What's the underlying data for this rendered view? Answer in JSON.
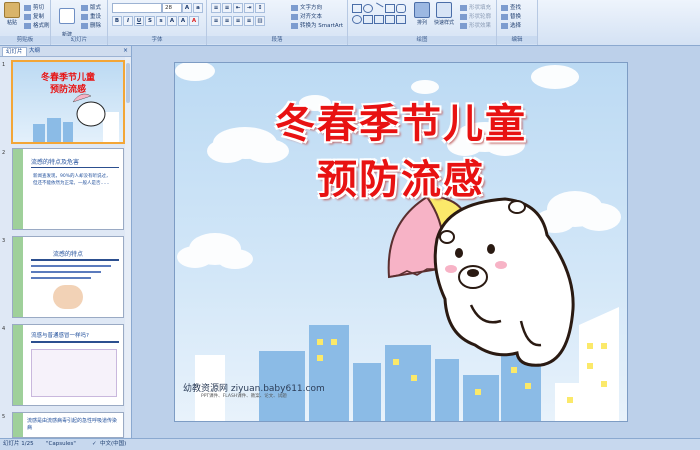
{
  "ribbon": {
    "clipboard": {
      "label": "剪贴板",
      "paste": "粘贴",
      "cut": "剪切",
      "copy": "复制",
      "format_painter": "格式刷"
    },
    "slides": {
      "label": "幻灯片",
      "new_slide": "新建\n幻灯片",
      "layout": "版式",
      "reset": "重设",
      "delete": "删除"
    },
    "font": {
      "label": "字体",
      "font_name": "",
      "font_size": "28"
    },
    "paragraph": {
      "label": "段落",
      "text_direction": "文字方向",
      "align_text": "对齐文本",
      "smartart": "转换为 SmartArt"
    },
    "drawing": {
      "label": "绘图",
      "arrange": "排列",
      "quick_styles": "快速样式",
      "shape_fill": "形状填充",
      "shape_outline": "形状轮廓",
      "shape_effects": "形状效果"
    },
    "editing": {
      "label": "编辑",
      "find": "查找",
      "replace": "替换",
      "select": "选择"
    }
  },
  "panel": {
    "tab_slides": "幻灯片",
    "tab_outline": "大纲",
    "close": "×",
    "thumbnails": [
      {
        "num": "1",
        "title": "冬春季节儿童",
        "subtitle": "预防流感"
      },
      {
        "num": "2",
        "title": "流感的特点及危害",
        "body": "新闻查发现，90%的人却没有听说过，但还不能依然为正常。一般人是否……"
      },
      {
        "num": "3",
        "title": "流感的特点"
      },
      {
        "num": "4",
        "title": "流感与普通感冒一样吗?"
      },
      {
        "num": "5",
        "title": "流感是由流感病毒引起的急性呼吸道传染病"
      }
    ]
  },
  "slide": {
    "title_line1": "冬春季节儿童",
    "title_line2": "预防流感",
    "watermark": "幼教资源网 ziyuan.baby611.com",
    "watermark_sub": "PPT课件、FLASH课件、教案、论文、试题"
  },
  "status": {
    "slide_pos": "幻灯片 1/25",
    "theme": "\"Capsules\"",
    "language": "中文(中国)"
  },
  "colors": {
    "title_red": "#e81212",
    "sky": "#bcdaf3",
    "building": "#8bbbe6",
    "selection": "#f3a637"
  }
}
